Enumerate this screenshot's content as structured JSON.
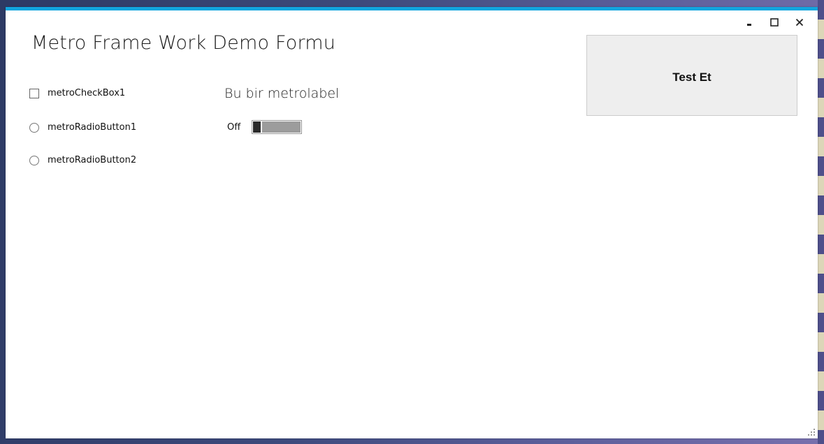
{
  "window": {
    "title": "Metro Frame Work Demo Formu",
    "accent_color": "#11a5de",
    "controls": {
      "minimize_icon": "minimize-icon",
      "maximize_icon": "maximize-icon",
      "close_icon": "close-icon"
    }
  },
  "controls": {
    "checkbox_label": "metroCheckBox1",
    "checkbox_checked": false,
    "radio1_label": "metroRadioButton1",
    "radio2_label": "metroRadioButton2",
    "metro_label": "Bu bir metrolabel",
    "toggle_text": "Off",
    "toggle_on": false,
    "test_button_label": "Test Et"
  }
}
